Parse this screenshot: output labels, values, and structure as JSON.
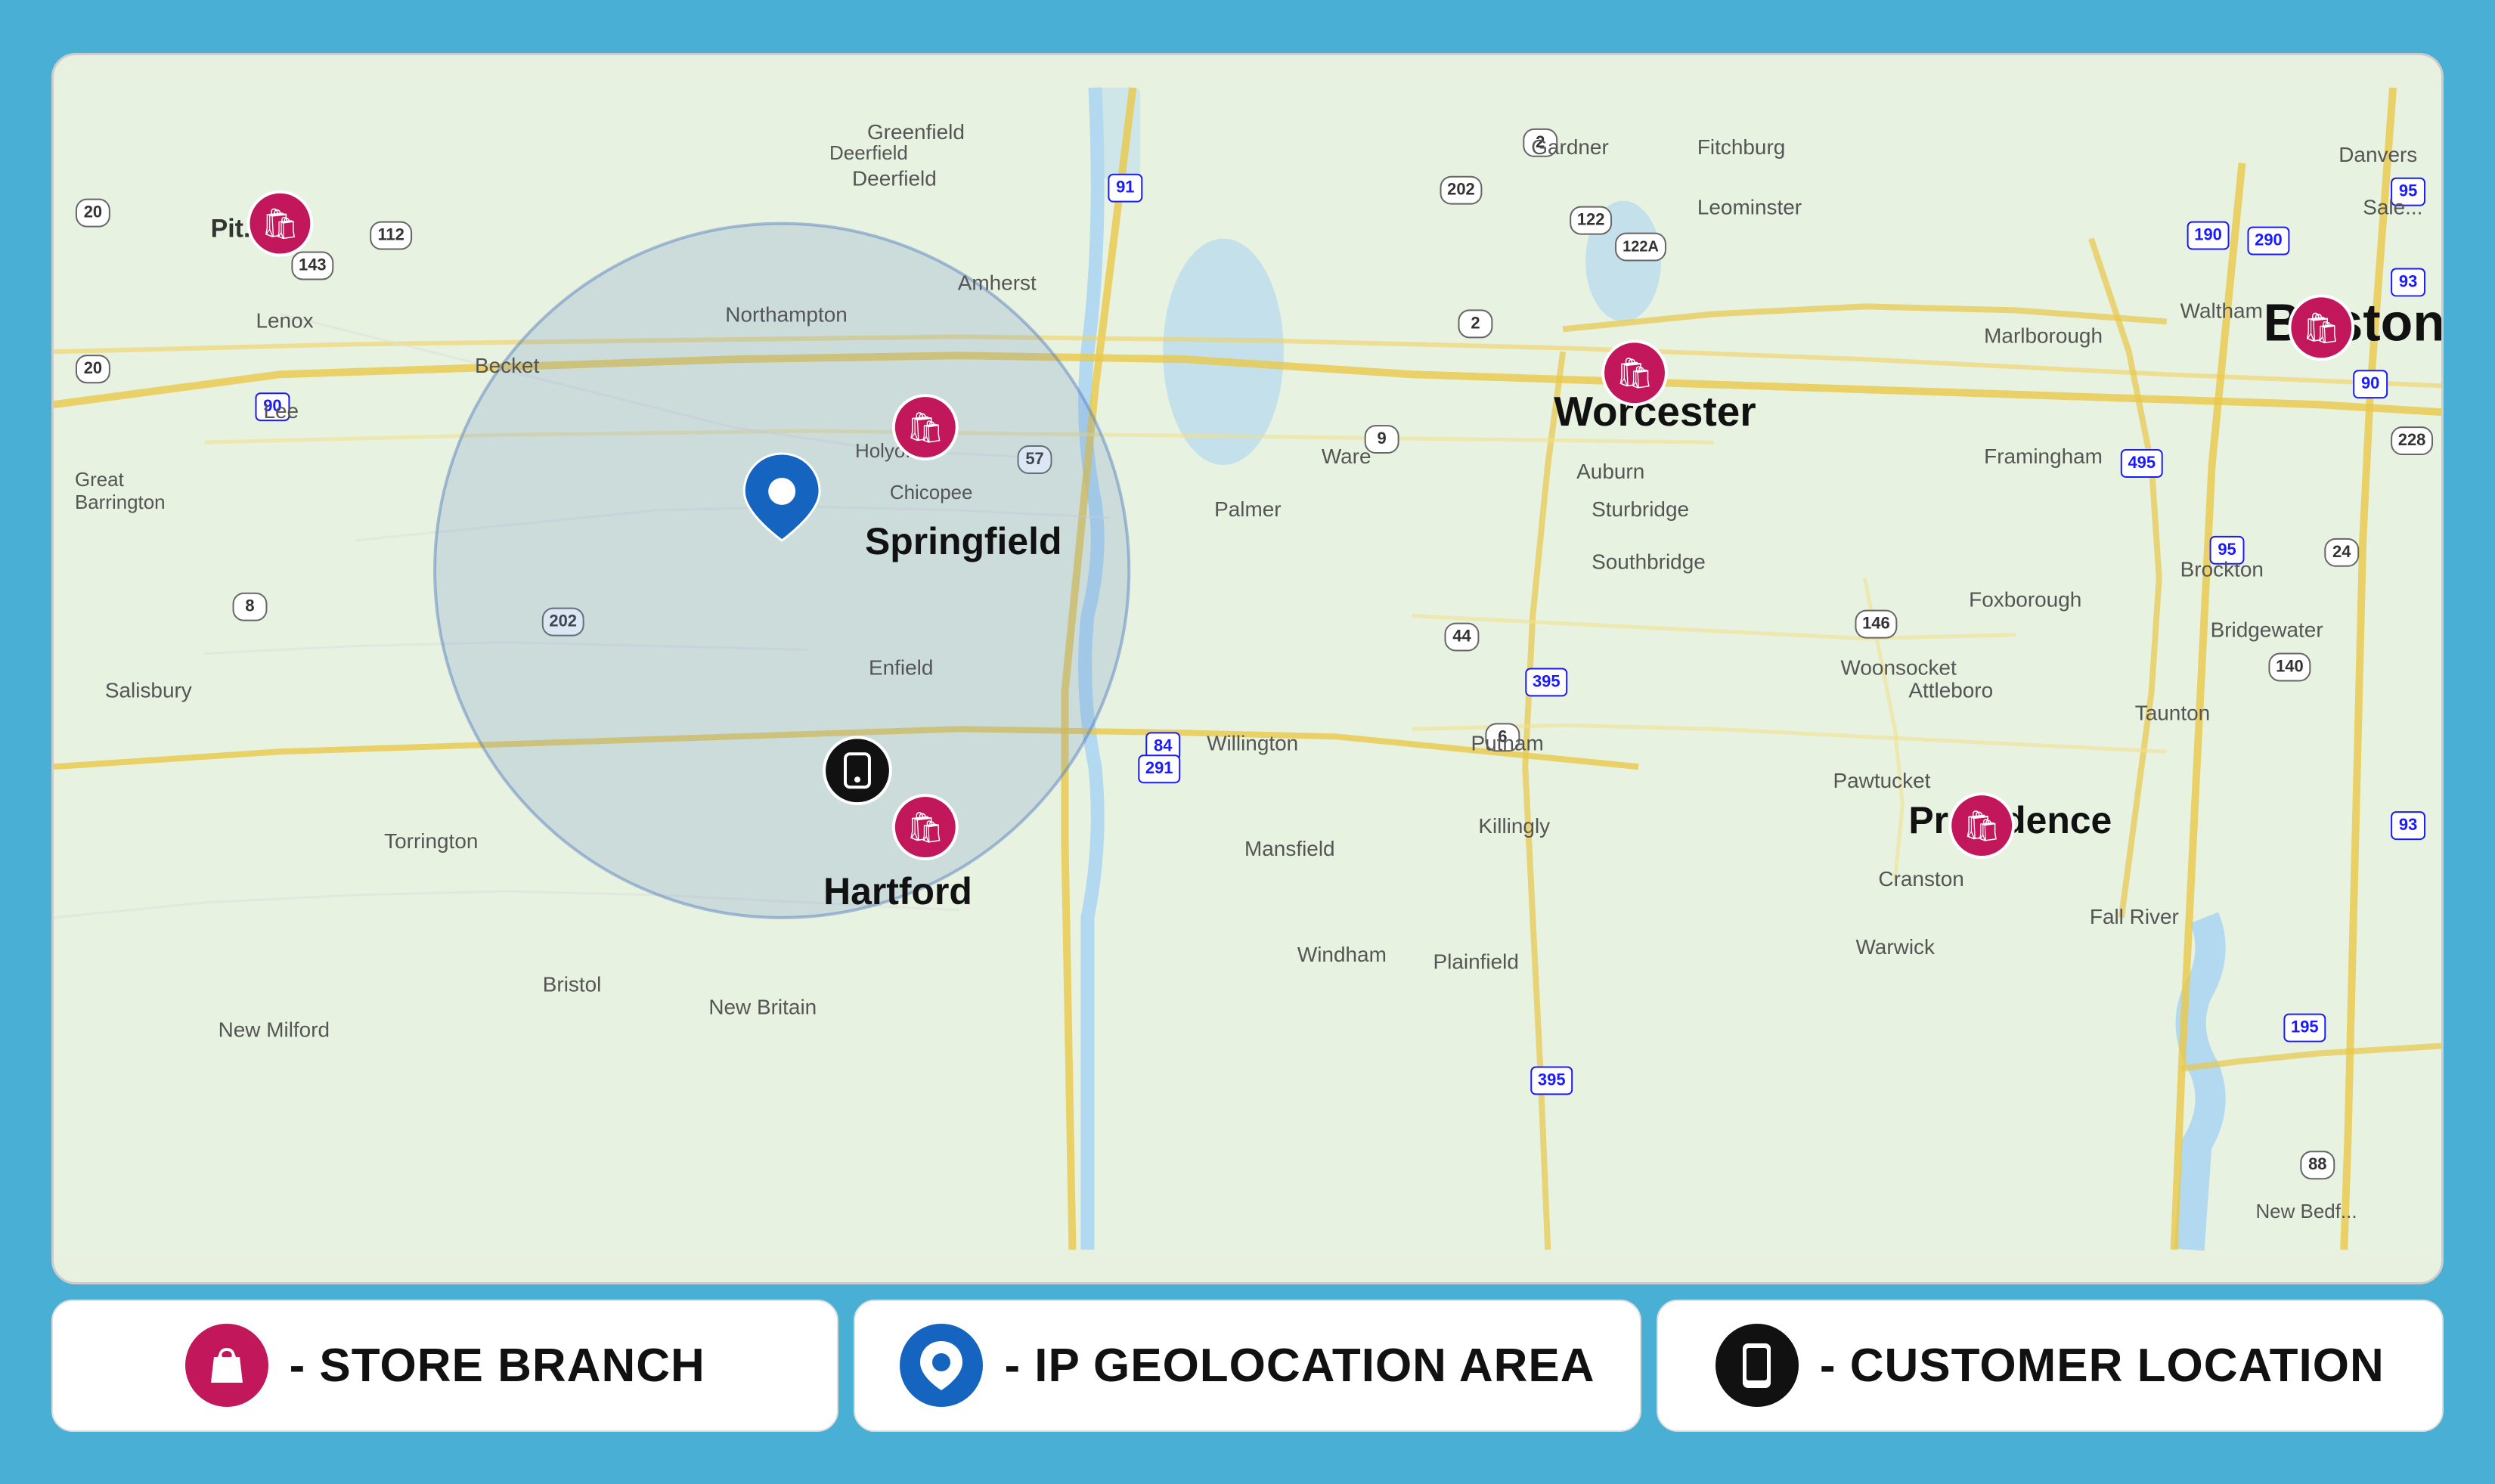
{
  "map": {
    "background_color": "#e8f2e0",
    "water_color": "#b3d9f0",
    "road_color": "#f5c842",
    "circle_fill": "rgba(100, 140, 200, 0.28)",
    "circle_stroke": "rgba(80, 120, 190, 0.5)",
    "circle_cx_pct": 0.31,
    "circle_cy_pct": 0.44,
    "circle_r_pct": 0.26,
    "places": [
      {
        "name": "Springfield",
        "x_pct": 0.355,
        "y_pct": 0.44,
        "style": "city-major"
      },
      {
        "name": "Hartford",
        "x_pct": 0.34,
        "y_pct": 0.77,
        "style": "city-major"
      },
      {
        "name": "Worcester",
        "x_pct": 0.64,
        "y_pct": 0.32,
        "style": "city-major"
      },
      {
        "name": "Boston",
        "x_pct": 0.935,
        "y_pct": 0.23,
        "style": "city-major"
      },
      {
        "name": "Providence",
        "x_pct": 0.8,
        "y_pct": 0.7,
        "style": "city-major"
      },
      {
        "name": "Northampton",
        "x_pct": 0.295,
        "y_pct": 0.22,
        "style": "bold"
      },
      {
        "name": "Amherst",
        "x_pct": 0.38,
        "y_pct": 0.19,
        "style": "bold"
      },
      {
        "name": "Holyoke",
        "x_pct": 0.34,
        "y_pct": 0.35,
        "style": "normal"
      },
      {
        "name": "Chicopee",
        "x_pct": 0.365,
        "y_pct": 0.39,
        "style": "normal"
      },
      {
        "name": "Palmer",
        "x_pct": 0.49,
        "y_pct": 0.41,
        "style": "normal"
      },
      {
        "name": "Enfield",
        "x_pct": 0.35,
        "y_pct": 0.55,
        "style": "normal"
      },
      {
        "name": "Willington",
        "x_pct": 0.49,
        "y_pct": 0.62,
        "style": "normal"
      },
      {
        "name": "Mansfield",
        "x_pct": 0.51,
        "y_pct": 0.72,
        "style": "normal"
      },
      {
        "name": "Windham",
        "x_pct": 0.53,
        "y_pct": 0.81,
        "style": "normal"
      },
      {
        "name": "Plainfield",
        "x_pct": 0.59,
        "y_pct": 0.82,
        "style": "normal"
      },
      {
        "name": "Putnam",
        "x_pct": 0.6,
        "y_pct": 0.62,
        "style": "normal"
      },
      {
        "name": "Killingly",
        "x_pct": 0.61,
        "y_pct": 0.7,
        "style": "normal"
      },
      {
        "name": "Sturbridge",
        "x_pct": 0.66,
        "y_pct": 0.4,
        "style": "normal"
      },
      {
        "name": "Southbridge",
        "x_pct": 0.66,
        "y_pct": 0.46,
        "style": "normal"
      },
      {
        "name": "Auburn",
        "x_pct": 0.64,
        "y_pct": 0.38,
        "style": "normal"
      },
      {
        "name": "Ware",
        "x_pct": 0.54,
        "y_pct": 0.35,
        "style": "normal"
      },
      {
        "name": "Framingham",
        "x_pct": 0.84,
        "y_pct": 0.34,
        "style": "normal"
      },
      {
        "name": "Marlborough",
        "x_pct": 0.83,
        "y_pct": 0.24,
        "style": "normal"
      },
      {
        "name": "Woonsocket",
        "x_pct": 0.77,
        "y_pct": 0.56,
        "style": "normal"
      },
      {
        "name": "Pawtucket",
        "x_pct": 0.76,
        "y_pct": 0.65,
        "style": "normal"
      },
      {
        "name": "Cranston",
        "x_pct": 0.78,
        "y_pct": 0.74,
        "style": "normal"
      },
      {
        "name": "Warwick",
        "x_pct": 0.77,
        "y_pct": 0.8,
        "style": "normal"
      },
      {
        "name": "Attleboro",
        "x_pct": 0.79,
        "y_pct": 0.57,
        "style": "normal"
      },
      {
        "name": "Foxborough",
        "x_pct": 0.82,
        "y_pct": 0.48,
        "style": "normal"
      },
      {
        "name": "Brockton",
        "x_pct": 0.91,
        "y_pct": 0.46,
        "style": "normal"
      },
      {
        "name": "Taunton",
        "x_pct": 0.89,
        "y_pct": 0.59,
        "style": "normal"
      },
      {
        "name": "Fall River",
        "x_pct": 0.87,
        "y_pct": 0.78,
        "style": "normal"
      },
      {
        "name": "Bridgewater",
        "x_pct": 0.93,
        "y_pct": 0.52,
        "style": "normal"
      },
      {
        "name": "Waltham",
        "x_pct": 0.9,
        "y_pct": 0.22,
        "style": "normal"
      },
      {
        "name": "New Milford",
        "x_pct": 0.09,
        "y_pct": 0.89,
        "style": "normal"
      },
      {
        "name": "Torrington",
        "x_pct": 0.175,
        "y_pct": 0.71,
        "style": "normal"
      },
      {
        "name": "Bristol",
        "x_pct": 0.235,
        "y_pct": 0.84,
        "style": "normal"
      },
      {
        "name": "New Britain",
        "x_pct": 0.3,
        "y_pct": 0.86,
        "style": "normal"
      },
      {
        "name": "Salisbury",
        "x_pct": 0.06,
        "y_pct": 0.57,
        "style": "normal"
      },
      {
        "name": "Great Barrington",
        "x_pct": 0.06,
        "y_pct": 0.37,
        "style": "normal"
      },
      {
        "name": "Lee",
        "x_pct": 0.1,
        "y_pct": 0.31,
        "style": "normal"
      },
      {
        "name": "Lenox",
        "x_pct": 0.11,
        "y_pct": 0.22,
        "style": "normal"
      },
      {
        "name": "Becket",
        "x_pct": 0.195,
        "y_pct": 0.27,
        "style": "normal"
      },
      {
        "name": "Pittsfield",
        "x_pct": 0.085,
        "y_pct": 0.145,
        "style": "bold"
      },
      {
        "name": "Deerfield",
        "x_pct": 0.34,
        "y_pct": 0.095,
        "style": "normal"
      },
      {
        "name": "Greenfield",
        "x_pct": 0.35,
        "y_pct": 0.05,
        "style": "normal"
      },
      {
        "name": "Gardner",
        "x_pct": 0.63,
        "y_pct": 0.06,
        "style": "normal"
      },
      {
        "name": "Fitchburg",
        "x_pct": 0.7,
        "y_pct": 0.06,
        "style": "normal"
      },
      {
        "name": "Leominster",
        "x_pct": 0.71,
        "y_pct": 0.12,
        "style": "normal"
      },
      {
        "name": "Danvers",
        "x_pct": 0.94,
        "y_pct": 0.07,
        "style": "normal"
      },
      {
        "name": "Salem",
        "x_pct": 0.95,
        "y_pct": 0.12,
        "style": "normal"
      }
    ],
    "store_markers": [
      {
        "x_pct": 0.103,
        "y_pct": 0.145
      },
      {
        "x_pct": 0.367,
        "y_pct": 0.37
      },
      {
        "x_pct": 0.365,
        "y_pct": 0.71
      },
      {
        "x_pct": 0.66,
        "y_pct": 0.28
      },
      {
        "x_pct": 0.945,
        "y_pct": 0.23
      },
      {
        "x_pct": 0.8,
        "y_pct": 0.7
      }
    ],
    "ip_marker": {
      "x_pct": 0.305,
      "y_pct": 0.4
    },
    "customer_marker": {
      "x_pct": 0.337,
      "y_pct": 0.635
    }
  },
  "legend": {
    "store_label": "- STORE BRANCH",
    "geo_label": "- IP GEOLOCATION AREA",
    "customer_label": "- CUSTOMER LOCATION"
  }
}
